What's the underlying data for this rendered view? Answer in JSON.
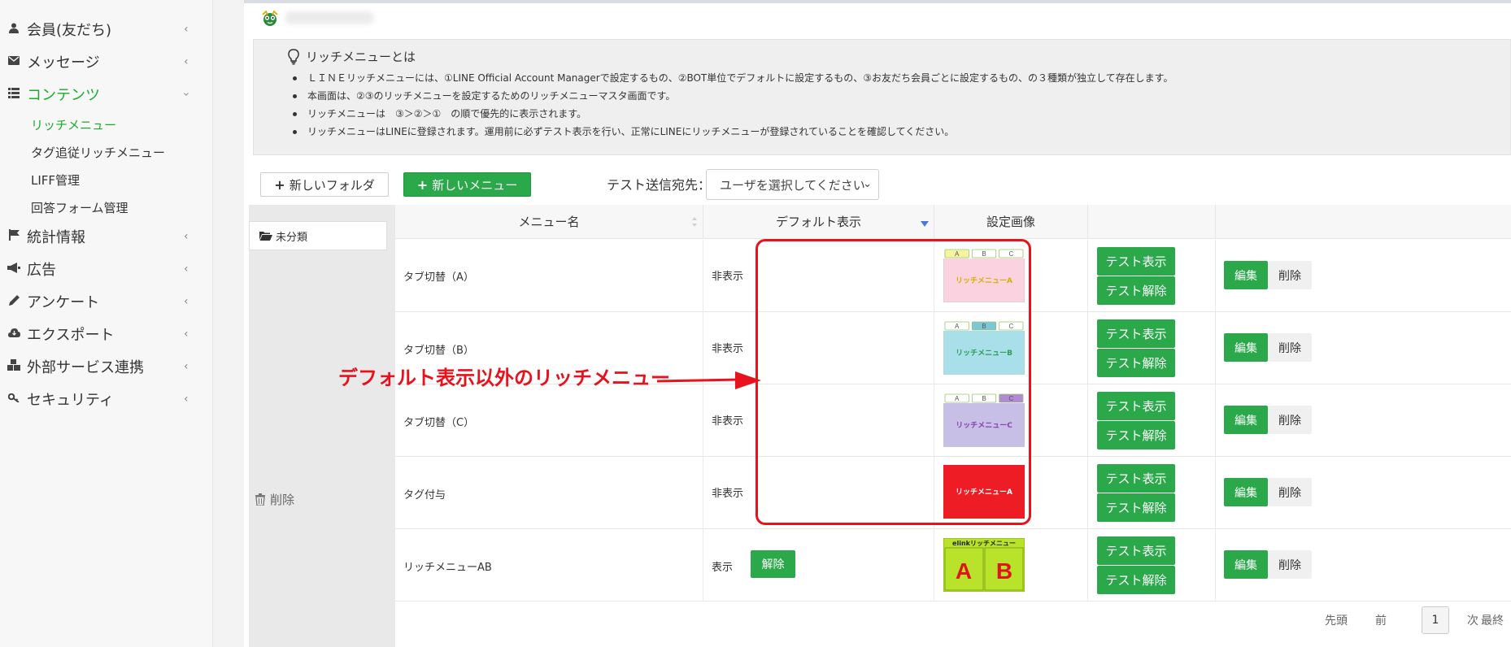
{
  "sidebar": {
    "items": [
      {
        "label": "会員(友だち)",
        "icon": "user-icon"
      },
      {
        "label": "メッセージ",
        "icon": "envelope-icon"
      },
      {
        "label": "コンテンツ",
        "icon": "list-icon",
        "active": true
      },
      {
        "label": "統計情報",
        "icon": "flag-icon"
      },
      {
        "label": "広告",
        "icon": "bullhorn-icon"
      },
      {
        "label": "アンケート",
        "icon": "pencil-icon"
      },
      {
        "label": "エクスポート",
        "icon": "cloud-download-icon"
      },
      {
        "label": "外部サービス連携",
        "icon": "cubes-icon"
      },
      {
        "label": "セキュリティ",
        "icon": "key-icon"
      }
    ],
    "sub_items": [
      {
        "label": "リッチメニュー",
        "active": true
      },
      {
        "label": "タグ追従リッチメニュー"
      },
      {
        "label": "LIFF管理"
      },
      {
        "label": "回答フォーム管理"
      }
    ]
  },
  "info": {
    "title": "リッチメニューとは",
    "items": [
      "ＬＩＮＥリッチメニューには、①LINE Official Account Managerで設定するもの、②BOT単位でデフォルトに設定するもの、③お友だち会員ごとに設定するもの、の３種類が独立して存在します。",
      "本画面は、②③のリッチメニューを設定するためのリッチメニューマスタ画面です。",
      "リッチメニューは　③＞②＞①　の順で優先的に表示されます。",
      "リッチメニューはLINEに登録されます。運用前に必ずテスト表示を行い、正常にLINEにリッチメニューが登録されていることを確認してください。"
    ]
  },
  "toolbar": {
    "new_folder": "新しいフォルダ",
    "new_menu": "新しいメニュー",
    "send_label": "テスト送信宛先：",
    "select_placeholder": "ユーザを選択してください"
  },
  "folders": {
    "uncategorized": "未分類",
    "delete": "削除"
  },
  "table": {
    "headers": [
      "メニュー名",
      "デフォルト表示",
      "設定画像"
    ],
    "rows": [
      {
        "name": "タブ切替（A）",
        "default": "非表示",
        "image": {
          "type": "tab",
          "tabs": [
            "A",
            "B",
            "C"
          ],
          "active": 0,
          "label": "リッチメニューA",
          "bg": "#fbd3e0",
          "fg": "#d6b000",
          "accent": "#f5f5a0"
        }
      },
      {
        "name": "タブ切替（B）",
        "default": "非表示",
        "image": {
          "type": "tab",
          "tabs": [
            "A",
            "B",
            "C"
          ],
          "active": 1,
          "label": "リッチメニューB",
          "bg": "#a8dfe9",
          "fg": "#2f9c5a",
          "accent": "#7ec7d4"
        }
      },
      {
        "name": "タブ切替（C）",
        "default": "非表示",
        "image": {
          "type": "tab",
          "tabs": [
            "A",
            "B",
            "C"
          ],
          "active": 2,
          "label": "リッチメニューC",
          "bg": "#c8bfe6",
          "fg": "#8a3fb0",
          "accent": "#b18ad6"
        }
      },
      {
        "name": "タグ付与",
        "default": "非表示",
        "image": {
          "type": "solid",
          "label": "リッチメニューA",
          "bg": "#ee1c25",
          "fg": "#ffffff"
        }
      },
      {
        "name": "リッチメニューAB",
        "default": "表示",
        "release": "解除",
        "image": {
          "type": "ab",
          "title": "elinkリッチメニュー",
          "letters": [
            "A",
            "B"
          ],
          "bg": "#b9e22b",
          "fg": "#e0141c"
        }
      }
    ],
    "test_show": "テスト表示",
    "test_release": "テスト解除",
    "edit": "編集",
    "delete": "削除"
  },
  "annotation": {
    "text": "デフォルト表示以外のリッチメニュー",
    "color": "#e8121c"
  },
  "pagination": {
    "first": "先頭",
    "prev": "前",
    "current": "1",
    "next": "次",
    "last": "最終"
  },
  "colors": {
    "accent_green": "#1aab2d",
    "button_green": "#2aa84a",
    "annotation_red": "#e8121c"
  }
}
